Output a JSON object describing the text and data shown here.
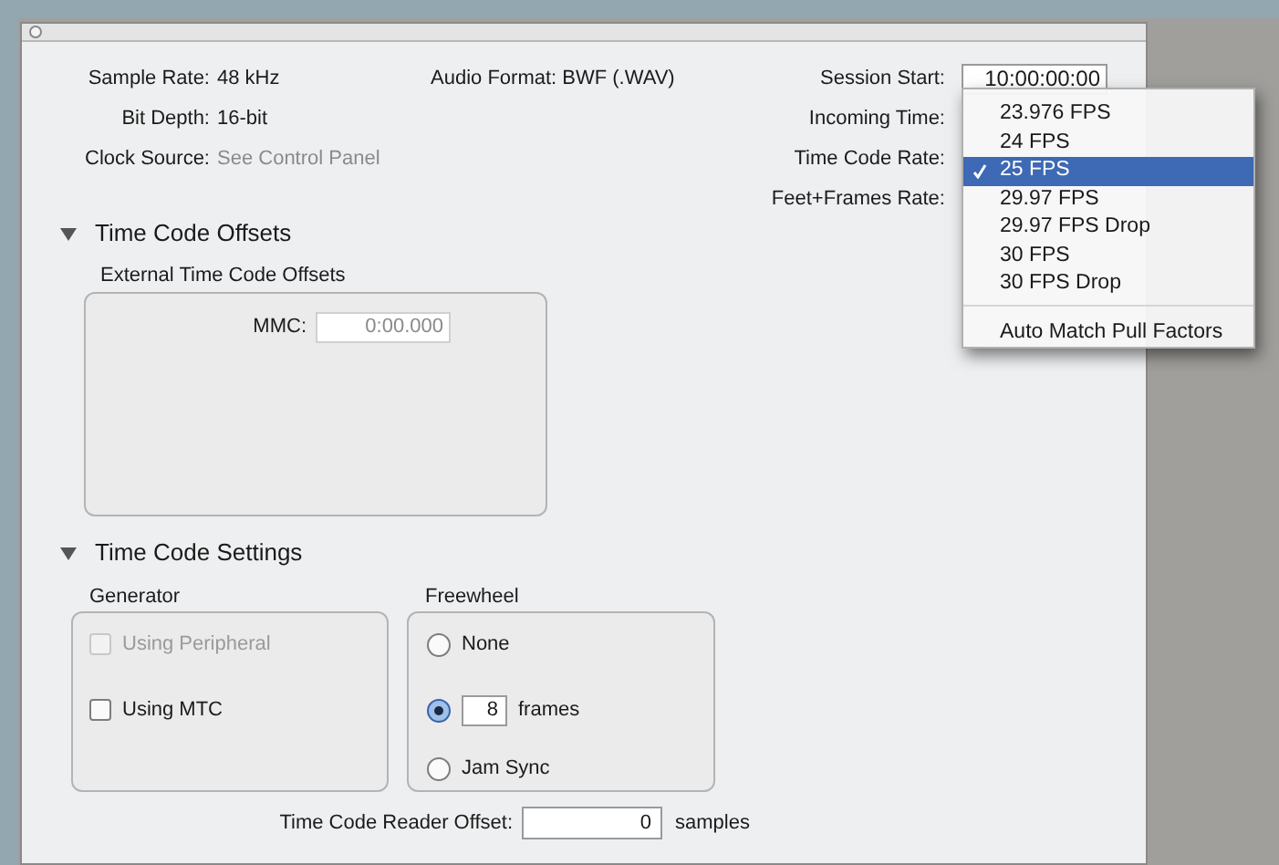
{
  "info_left": [
    {
      "label": "Sample Rate:",
      "value": "48 kHz",
      "dimmed": false
    },
    {
      "label": "Bit Depth:",
      "value": "16-bit",
      "dimmed": false
    },
    {
      "label": "Clock Source:",
      "value": "See Control Panel",
      "dimmed": true
    }
  ],
  "audio_format": "Audio Format: BWF (.WAV)",
  "info_right": [
    {
      "label": "Session Start:",
      "value": "10:00:00:00"
    },
    {
      "label": "Incoming Time:"
    },
    {
      "label": "Time Code Rate:"
    },
    {
      "label": "Feet+Frames Rate:"
    }
  ],
  "rate_menu": {
    "items": [
      {
        "label": "23.976 FPS",
        "selected": false
      },
      {
        "label": "24 FPS",
        "selected": false
      },
      {
        "label": "25 FPS",
        "selected": true
      },
      {
        "label": "29.97 FPS",
        "selected": false
      },
      {
        "label": "29.97 FPS Drop",
        "selected": false
      },
      {
        "label": "30 FPS",
        "selected": false
      },
      {
        "label": "30 FPS Drop",
        "selected": false
      }
    ],
    "extra_item": "Auto Match Pull Factors"
  },
  "time_code_offsets": {
    "title": "Time Code Offsets",
    "expanded": true,
    "group_title": "External Time Code Offsets",
    "mmc": {
      "label": "MMC:",
      "value": "0:00.000",
      "disabled": true
    }
  },
  "time_code_settings": {
    "title": "Time Code Settings",
    "expanded": true,
    "generator": {
      "title": "Generator",
      "options": [
        {
          "label": "Using Peripheral",
          "checked": false,
          "disabled": true
        },
        {
          "label": "Using MTC",
          "checked": false,
          "disabled": false
        }
      ]
    },
    "freewheel": {
      "title": "Freewheel",
      "options": [
        {
          "kind": "radio",
          "label": "None",
          "selected": false
        },
        {
          "kind": "radio-field",
          "value": "8",
          "unit": "frames",
          "selected": true
        },
        {
          "kind": "radio",
          "label": "Jam Sync",
          "selected": false
        }
      ]
    },
    "reader_offset": {
      "label": "Time Code Reader Offset:",
      "value": "0",
      "unit": "samples"
    }
  }
}
